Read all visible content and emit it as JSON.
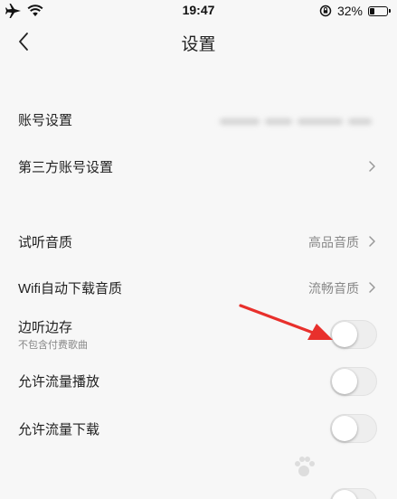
{
  "status_bar": {
    "time": "19:47",
    "battery_percent": "32%",
    "battery_level": 0.32,
    "icons": [
      "airplane-icon",
      "wifi-icon",
      "rotation-lock-icon",
      "battery-icon"
    ]
  },
  "nav": {
    "title": "设置",
    "back_icon": "chevron-left-icon"
  },
  "rows": {
    "account": {
      "label": "账号设置"
    },
    "third_party": {
      "label": "第三方账号设置"
    },
    "preview_quality": {
      "label": "试听音质",
      "value": "高品音质"
    },
    "wifi_download": {
      "label": "Wifi自动下载音质",
      "value": "流畅音质"
    },
    "listen_save": {
      "label": "边听边存",
      "sublabel": "不包含付费歌曲",
      "on": false
    },
    "data_play": {
      "label": "允许流量播放",
      "on": false
    },
    "data_download": {
      "label": "允许流量下载",
      "on": false
    }
  },
  "annotation": {
    "arrow_color": "#e8302c"
  },
  "colors": {
    "background": "#f7f7f7",
    "text": "#222222",
    "secondary_text": "#888888",
    "toggle_off": "#eeeeee"
  }
}
